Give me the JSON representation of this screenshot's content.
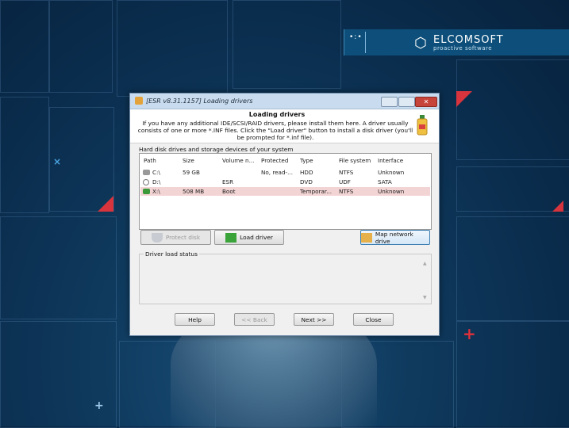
{
  "brand": {
    "name": "ELCOMSOFT",
    "tagline": "proactive software",
    "dots": "•:•"
  },
  "window": {
    "title": "[ESR v8.31.1157]  Loading drivers",
    "close_glyph": "✕",
    "header_title": "Loading drivers",
    "header_desc": "If you have any additional IDE/SCSI/RAID drivers, please install them here. A driver usually consists of one or more *.INF files. Click the \"Load driver\" button to install a disk driver (you'll be prompted for *.inf file).",
    "section_label": "Hard disk drives and storage devices of your system",
    "columns": [
      "Path",
      "Size",
      "Volume n...",
      "Protected",
      "Type",
      "File system",
      "Interface"
    ],
    "rows": [
      {
        "icon": "hdd-icon",
        "path": "C:\\",
        "size": "59 GB",
        "volume": "",
        "protected": "No, read-...",
        "type": "HDD",
        "fs": "NTFS",
        "iface": "Unknown"
      },
      {
        "icon": "cd-icon",
        "path": "D:\\",
        "size": "",
        "volume": "ESR",
        "protected": "",
        "type": "DVD",
        "fs": "UDF",
        "iface": "SATA"
      },
      {
        "icon": "usb-icon",
        "path": "X:\\",
        "size": "508 MB",
        "volume": "Boot",
        "protected": "",
        "type": "Temporar...",
        "fs": "NTFS",
        "iface": "Unknown"
      }
    ],
    "buttons": {
      "protect": "Protect disk",
      "load": "Load driver",
      "map": "Map network drive"
    },
    "status_label": "Driver load status",
    "nav": {
      "help": "Help",
      "back": "<< Back",
      "next": "Next >>",
      "close": "Close"
    }
  }
}
